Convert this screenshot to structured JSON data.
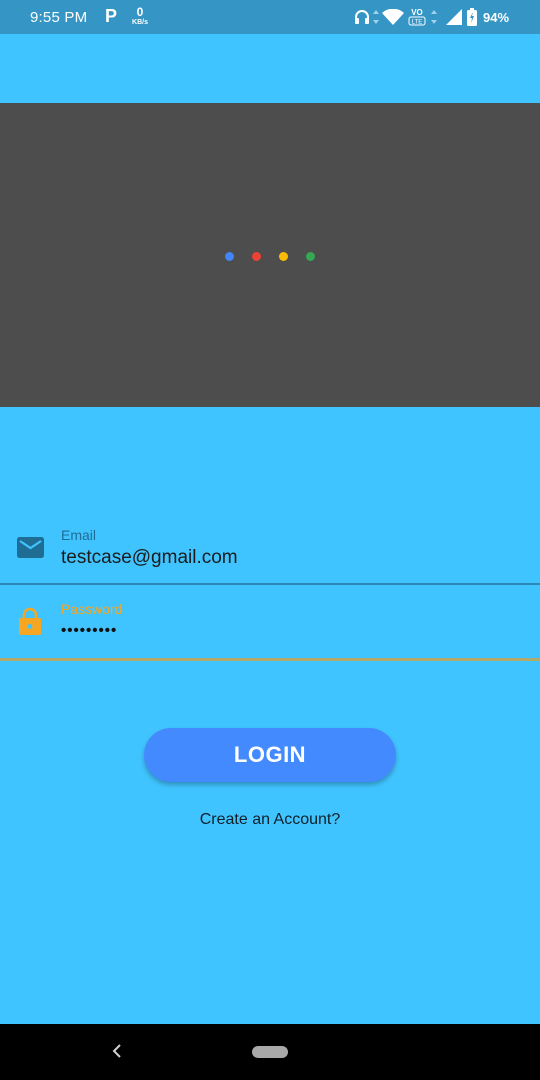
{
  "status_bar": {
    "time": "9:55 PM",
    "net_speed_value": "0",
    "net_speed_unit": "KB/s",
    "battery": "94%",
    "icons": [
      "p-icon",
      "headphones-icon",
      "wifi-icon",
      "volte-icon",
      "signal-icon",
      "battery-icon"
    ]
  },
  "loader": {
    "dot_colors": [
      "#4285f4",
      "#ea4335",
      "#fbbc05",
      "#34a853"
    ]
  },
  "form": {
    "email_label": "Email",
    "email_value": "testcase@gmail.com",
    "password_label": "Password",
    "password_value": "•••••••••"
  },
  "buttons": {
    "login": "LOGIN",
    "create_account": "Create an Account?"
  },
  "colors": {
    "background": "#40c4ff",
    "status_bar": "#3596c6",
    "webview": "#4d4d4d",
    "email_accent": "#1f6d95",
    "password_accent": "#f5a623",
    "login_button": "#448aff"
  },
  "nav_bar": {
    "icons": [
      "back-icon",
      "home-pill-icon"
    ]
  }
}
